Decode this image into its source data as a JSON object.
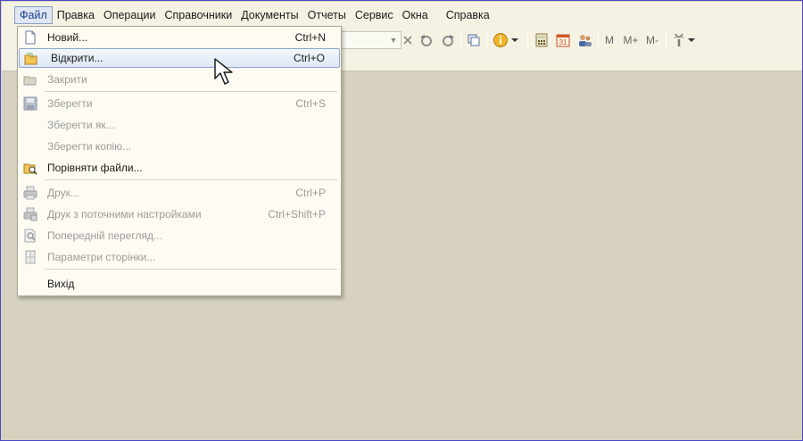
{
  "menubar": {
    "items": [
      "Файл",
      "Правка",
      "Операции",
      "Справочники",
      "Документы",
      "Отчеты",
      "Сервис",
      "Окна",
      "Справка"
    ]
  },
  "toolbar": {
    "buttons": [
      "M",
      "M+",
      "M-"
    ]
  },
  "file_menu": {
    "items": [
      {
        "label": "Новий...",
        "shortcut": "Ctrl+N"
      },
      {
        "label": "Відкрити...",
        "shortcut": "Ctrl+O"
      },
      {
        "label": "Закрити",
        "shortcut": ""
      },
      {
        "label": "Зберегти",
        "shortcut": "Ctrl+S"
      },
      {
        "label": "Зберегти як...",
        "shortcut": ""
      },
      {
        "label": "Зберегти копію...",
        "shortcut": ""
      },
      {
        "label": "Порівняти файли...",
        "shortcut": ""
      },
      {
        "label": "Друк...",
        "shortcut": "Ctrl+P"
      },
      {
        "label": "Друк з поточними настройками",
        "shortcut": "Ctrl+Shift+P"
      },
      {
        "label": "Попередній перегляд...",
        "shortcut": ""
      },
      {
        "label": "Параметри сторінки...",
        "shortcut": ""
      },
      {
        "label": "Вихід",
        "shortcut": ""
      }
    ]
  },
  "colors": {
    "workspace": "#d6d2bf",
    "menubar": "#f5f2e3",
    "highlight_border": "#8ea4cc"
  }
}
